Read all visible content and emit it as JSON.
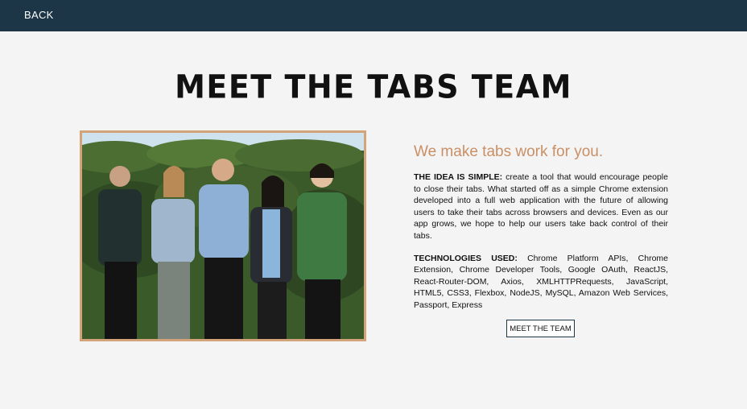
{
  "nav": {
    "back_label": "BACK"
  },
  "page": {
    "title": "MEET THE TABS TEAM"
  },
  "about": {
    "tagline": "We make tabs work for you.",
    "idea_heading": "THE IDEA IS SIMPLE:",
    "idea_text": " create a tool that would encourage people to close their tabs. What started off as a simple Chrome extension developed into a full web application with the future of allowing users to take their tabs across browsers and devices. Even as our app grows, we hope to help our users take back control of their tabs.",
    "tech_heading": "TECHNOLOGIES USED:",
    "tech_text": " Chrome Platform APIs, Chrome Extension, Chrome Developer Tools, Google OAuth, ReactJS, React-Router-DOM, Axios, XMLHTTPRequests, JavaScript, HTML5, CSS3, Flexbox, NodeJS, MySQL, Amazon Web Services, Passport, Express",
    "team_button_label": "MEET THE TEAM"
  },
  "colors": {
    "nav_bg": "#1c3547",
    "accent": "#c98f66",
    "frame_border": "#d3a47a"
  }
}
